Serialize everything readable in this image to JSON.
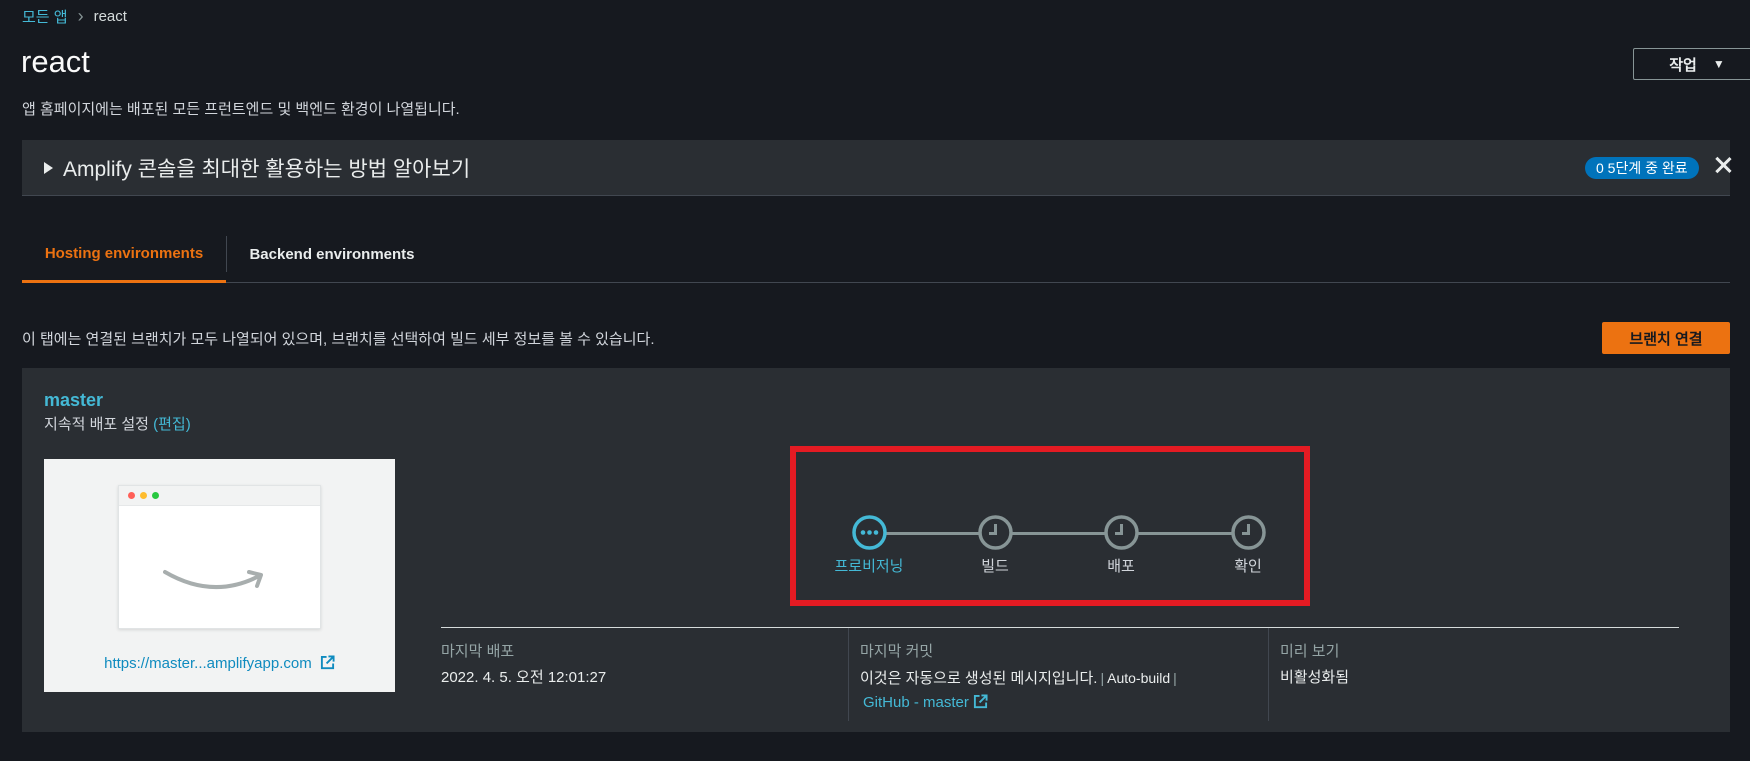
{
  "breadcrumb": {
    "parent": "모든 앱",
    "current": "react"
  },
  "page": {
    "title": "react",
    "subtitle": "앱 홈페이지에는 배포된 모든 프런트엔드 및 백엔드 환경이 나열됩니다.",
    "actions_label": "작업"
  },
  "info_panel": {
    "title": "Amplify 콘솔을 최대한 활용하는 방법 알아보기",
    "progress": "0 5단계 중 완료"
  },
  "tabs": [
    {
      "label": "Hosting environments",
      "active": true
    },
    {
      "label": "Backend environments",
      "active": false
    }
  ],
  "hosting": {
    "description": "이 탭에는 연결된 브랜치가 모두 나열되어 있으며, 브랜치를 선택하여 빌드 세부 정보를 볼 수 있습니다.",
    "connect_label": "브랜치 연결"
  },
  "branch": {
    "name": "master",
    "cd_label": "지속적 배포 설정",
    "edit_label": "(편집)",
    "preview_url": "https://master...amplifyapp.com",
    "pipeline": [
      {
        "label": "프로비저닝",
        "status": "in-progress"
      },
      {
        "label": "빌드",
        "status": "pending"
      },
      {
        "label": "배포",
        "status": "pending"
      },
      {
        "label": "확인",
        "status": "pending"
      }
    ],
    "last_deploy": {
      "label": "마지막 배포",
      "value": "2022. 4. 5. 오전 12:01:27"
    },
    "last_commit": {
      "label": "마지막 커밋",
      "message": "이것은 자동으로 생성된 메시지입니다.",
      "autobuild": "Auto-build",
      "link": "GitHub - master"
    },
    "preview_status": {
      "label": "미리 보기",
      "value": "비활성화됨"
    }
  },
  "colors": {
    "accent": "#ec7211",
    "link": "#44b9d6",
    "badge": "#0073bb",
    "highlight": "#e41b23",
    "background": "#16191f",
    "panel": "#2a2e33"
  },
  "icons": [
    "chevron-right-icon",
    "caret-down-icon",
    "triangle-right-icon",
    "close-icon",
    "external-link-icon",
    "in-progress-icon",
    "clock-icon",
    "amazon-smile-icon"
  ]
}
